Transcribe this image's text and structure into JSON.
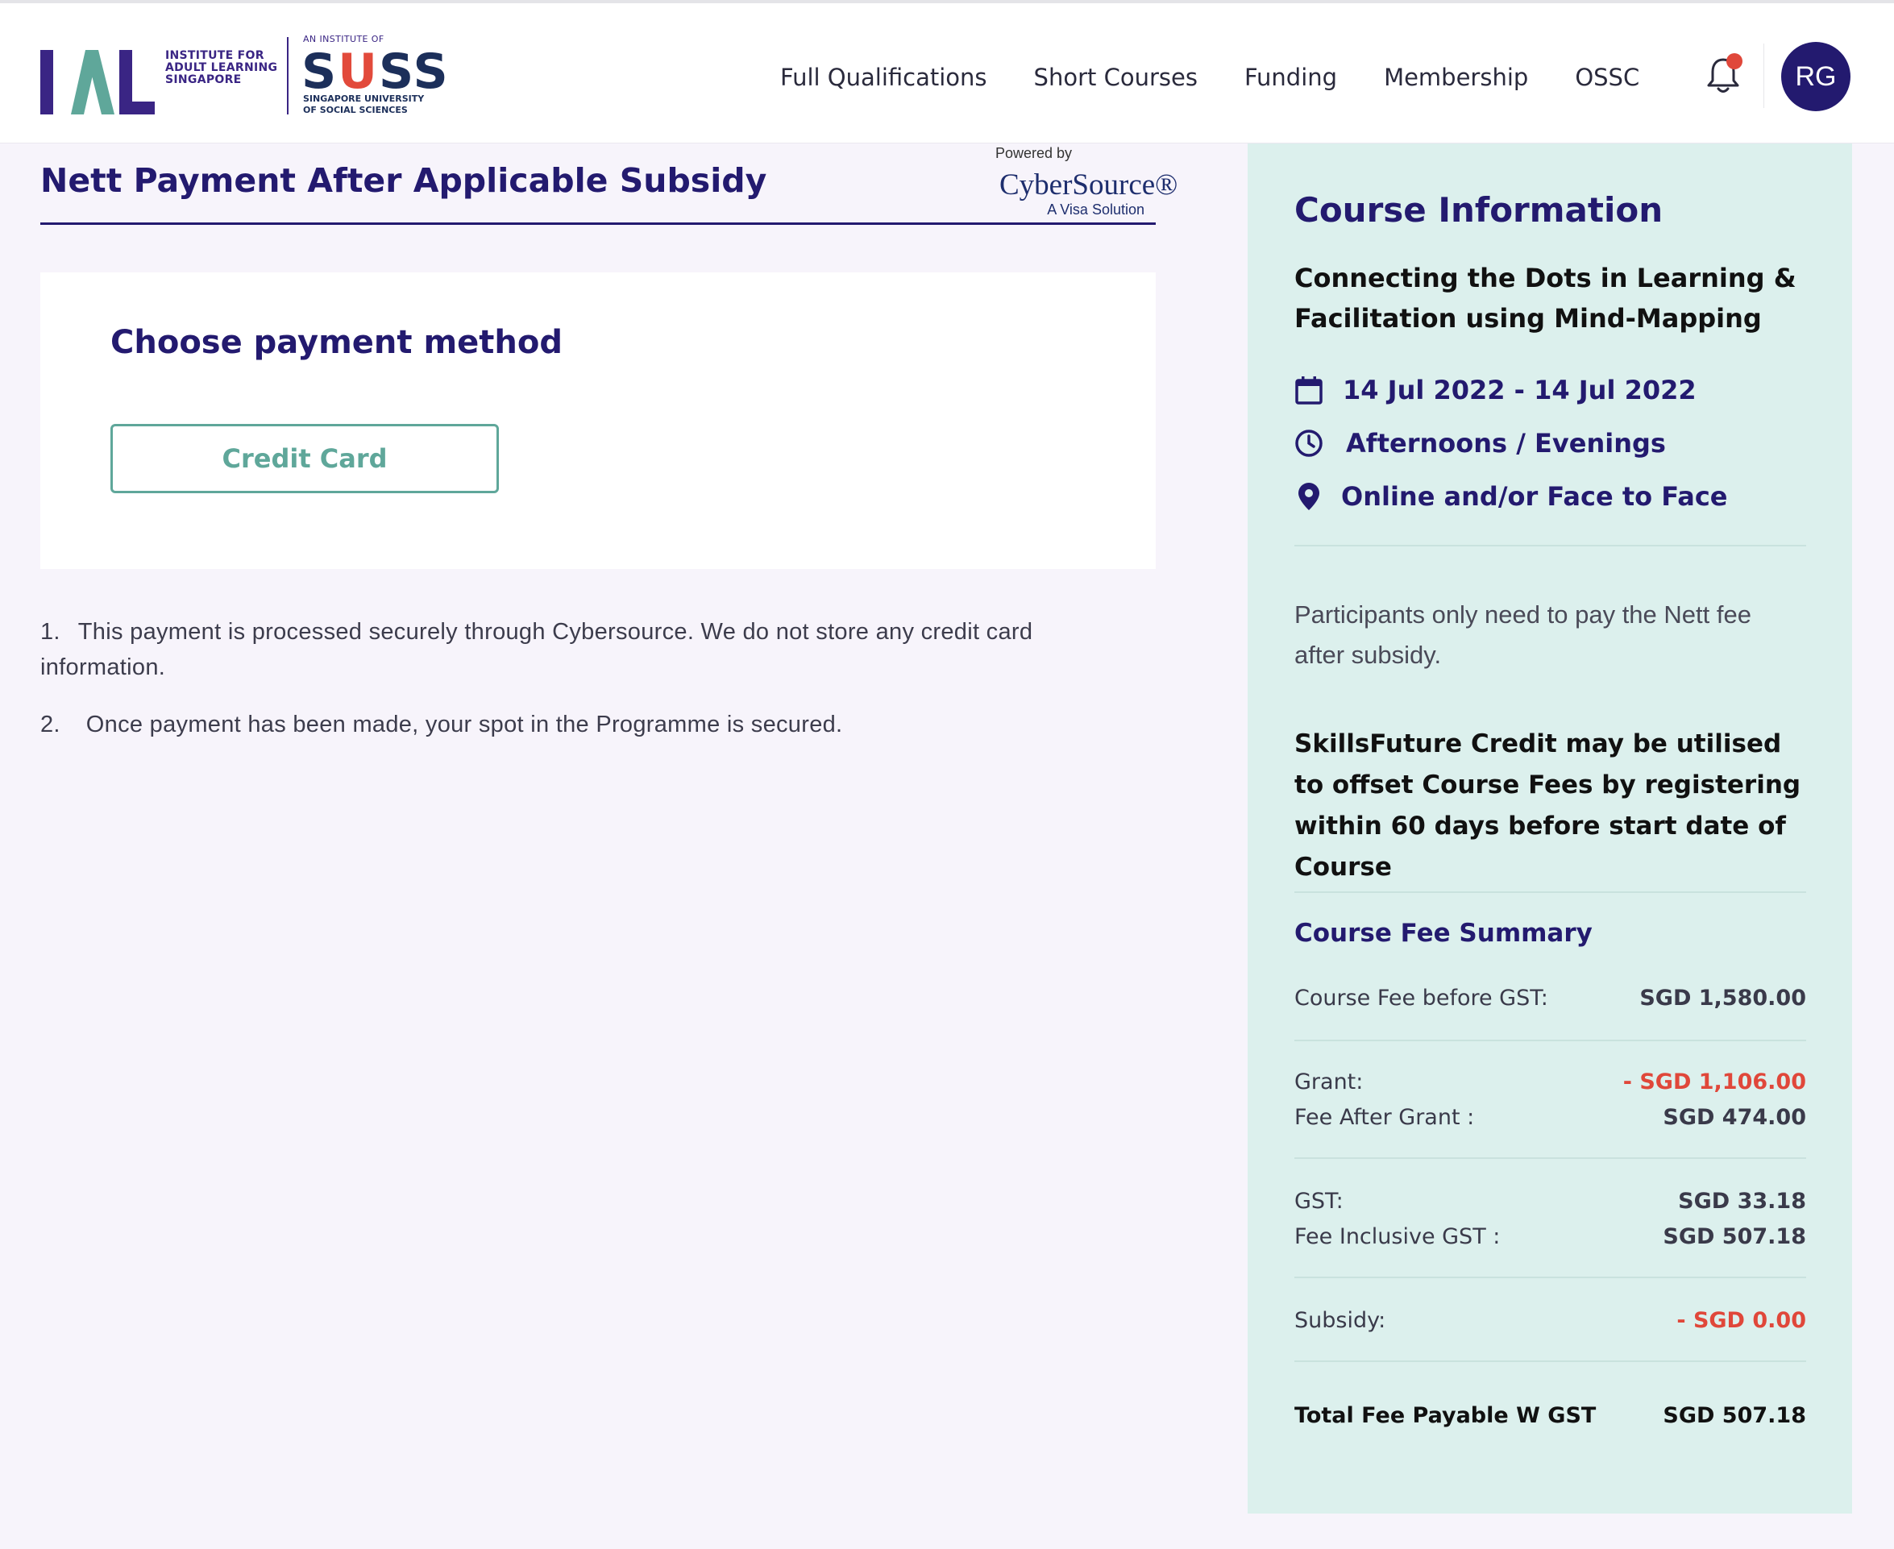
{
  "header": {
    "logo_ial_letters": "IAL",
    "logo_ial_lines": [
      "INSTITUTE FOR",
      "ADULT LEARNING",
      "SINGAPORE"
    ],
    "logo_suss_tag": "AN INSTITUTE OF",
    "logo_suss_word_s1": "S",
    "logo_suss_word_u": "U",
    "logo_suss_word_ss": "SS",
    "logo_suss_lines": [
      "SINGAPORE UNIVERSITY",
      "OF SOCIAL SCIENCES"
    ],
    "nav": [
      "Full Qualifications",
      "Short Courses",
      "Funding",
      "Membership",
      "OSSC"
    ],
    "avatar_initials": "RG",
    "icons": {
      "notification": "bell-icon"
    }
  },
  "main": {
    "title": "Nett Payment After Applicable Subsidy",
    "cybersource": {
      "powered": "Powered by",
      "name": "CyberSource®",
      "sub": "A Visa Solution"
    },
    "payment_heading": "Choose payment method",
    "credit_card_label": "Credit Card",
    "notes": [
      {
        "num": "1.",
        "text": "This payment is processed securely through Cybersource. We do not store any credit card information."
      },
      {
        "num": "2.",
        "text": "Once payment has been made, your spot in the Programme is secured."
      }
    ]
  },
  "panel": {
    "title": "Course Information",
    "course_name": "Connecting the Dots in Learning & Facilitation using Mind-Mapping",
    "dates": "14 Jul 2022 - 14 Jul 2022",
    "time": "Afternoons / Evenings",
    "mode": "Online and/or Face to Face",
    "note": "Participants only need to pay the Nett fee after subsidy.",
    "skillsfuture_note": "SkillsFuture Credit may be utilised to offset Course Fees by registering within 60 days before start date of Course",
    "fee_summary_title": "Course Fee Summary",
    "fees": {
      "before_gst": {
        "label": "Course Fee before GST:",
        "value": "SGD 1,580.00"
      },
      "grant": {
        "label": "Grant:",
        "value": "- SGD 1,106.00"
      },
      "after_grant": {
        "label": "Fee After Grant :",
        "value": "SGD 474.00"
      },
      "gst": {
        "label": "GST:",
        "value": "SGD 33.18"
      },
      "incl_gst": {
        "label": "Fee Inclusive GST :",
        "value": "SGD 507.18"
      },
      "subsidy": {
        "label": "Subsidy:",
        "value": "- SGD 0.00"
      },
      "total": {
        "label": "Total Fee Payable W GST",
        "value": "SGD 507.18"
      }
    },
    "colors": {
      "panel_bg": "#dcf0ed",
      "accent": "#231a6f",
      "negative": "#e0473a",
      "button": "#5fa79a"
    }
  }
}
